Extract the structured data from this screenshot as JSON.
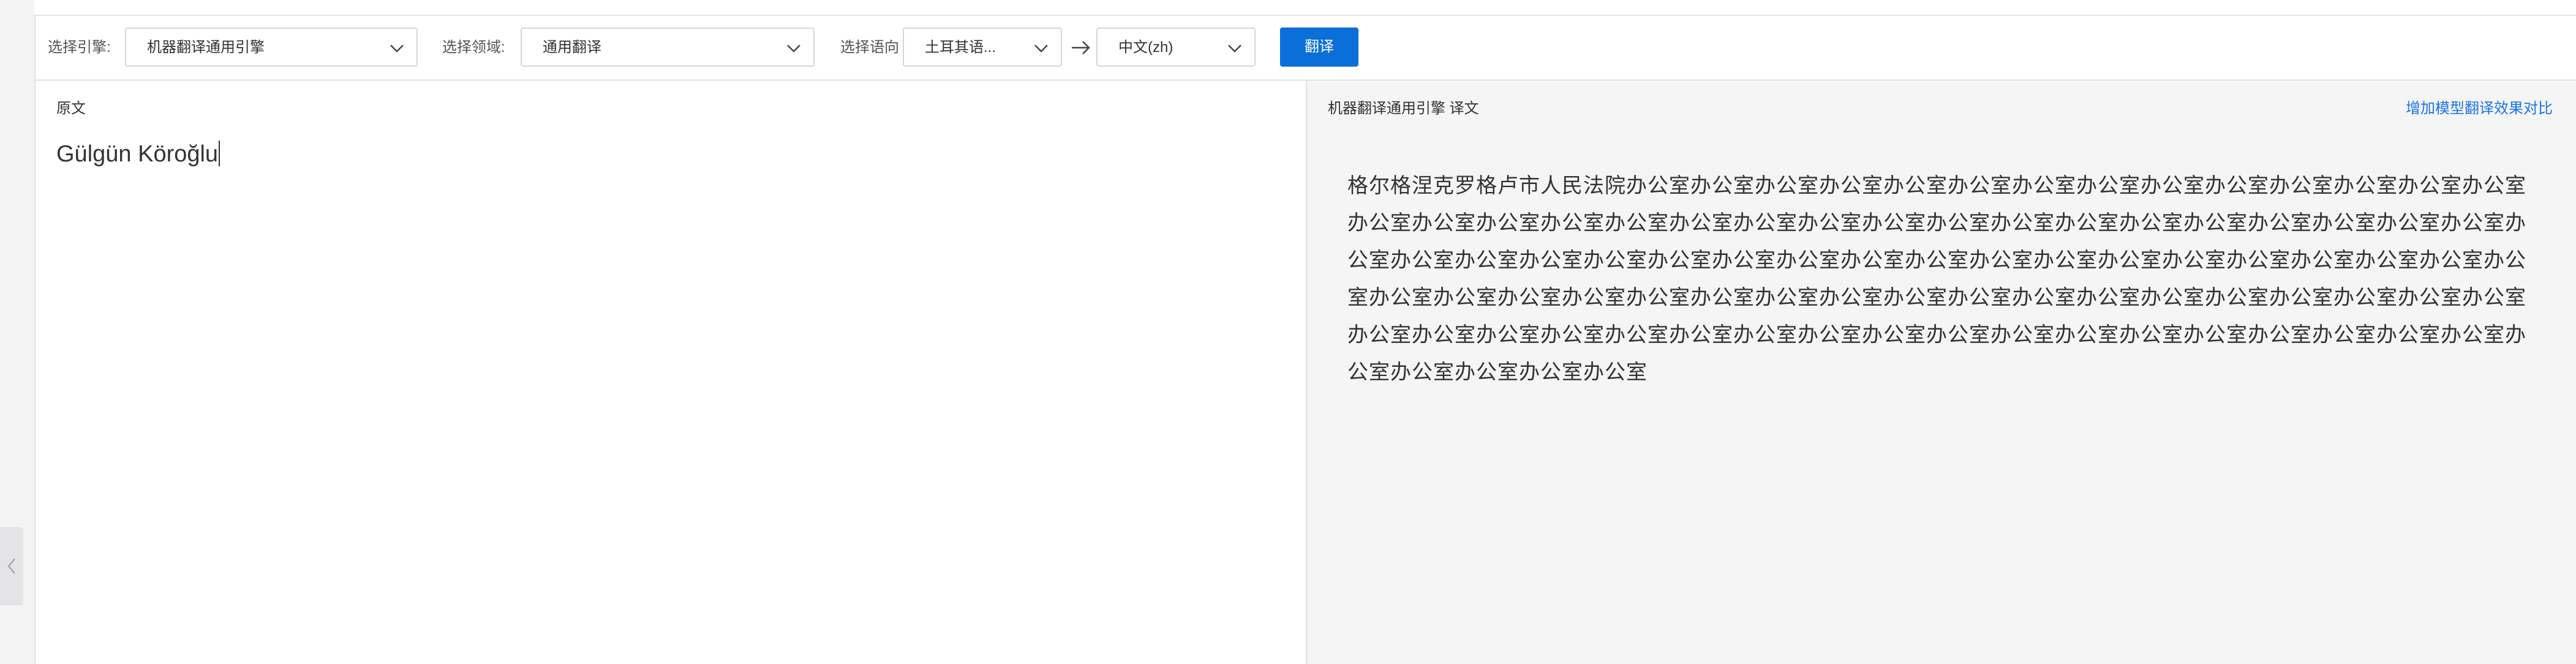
{
  "toolbar": {
    "engine_label": "选择引擎:",
    "engine_value": "机器翻译通用引擎",
    "domain_label": "选择领域:",
    "domain_value": "通用翻译",
    "direction_label": "选择语向",
    "source_lang": "土耳其语...",
    "target_lang": "中文(zh)",
    "translate_label": "翻译"
  },
  "source": {
    "title": "原文",
    "text": "Gülgün Köroğlu"
  },
  "result": {
    "title": "机器翻译通用引擎 译文",
    "compare_link": "增加模型翻译效果对比",
    "text": "格尔格涅克罗格卢市人民法院办公室办公室办公室办公室办公室办公室办公室办公室办公室办公室办公室办公室办公室办公室办公室办公室办公室办公室办公室办公室办公室办公室办公室办公室办公室办公室办公室办公室办公室办公室办公室办公室办公室办公室办公室办公室办公室办公室办公室办公室办公室办公室办公室办公室办公室办公室办公室办公室办公室办公室办公室办公室办公室办公室办公室办公室办公室办公室办公室办公室办公室办公室办公室办公室办公室办公室办公室办公室办公室办公室办公室办公室办公室办公室办公室办公室办公室办公室办公室办公室办公室办公室办公室办公室办公室办公室办公室办公室办公室办公室办公室办公室"
  },
  "icons": {
    "select_chevron": "chevron-down-icon",
    "direction_arrow": "arrow-right-icon",
    "collapse": "chevron-left-icon"
  },
  "colors": {
    "accent": "#0a6fd8",
    "link": "#1a73e8",
    "result_bg": "#f5f5f5"
  }
}
